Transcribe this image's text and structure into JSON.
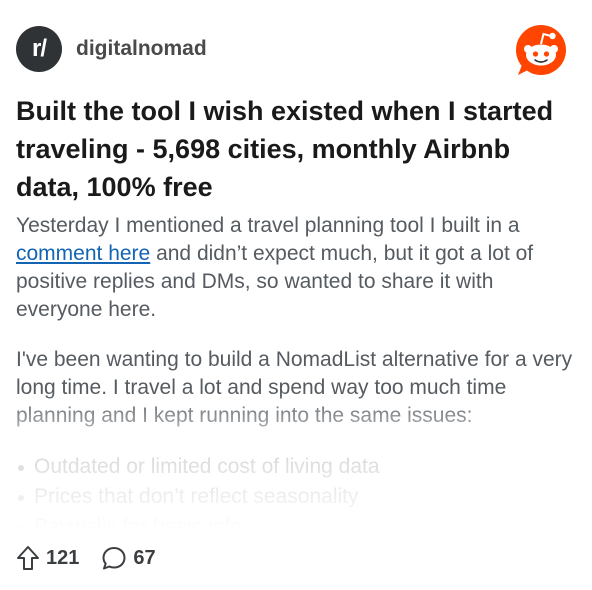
{
  "header": {
    "subreddit_icon": "r/",
    "subreddit_name": "digitalnomad",
    "logo": "reddit-snoo-icon"
  },
  "post": {
    "title": "Built the tool I wish existed when I started traveling - 5,698 cities, monthly Airbnb data, 100% free",
    "paragraph1_before_link": "Yesterday I mentioned a travel planning tool I built in a ",
    "paragraph1_link": "comment here",
    "paragraph1_after_link": " and didn’t expect much, but it got a lot of positive replies and DMs, so wanted to share it with everyone here.",
    "paragraph2": "I've been wanting to build a NomadList alternative for a very long time. I travel a lot and spend way too much time planning and I kept running into the same issues:",
    "bullets": [
      "Outdated or limited cost of living data",
      "Prices that don’t reflect seasonality",
      "Paywalls for basic info"
    ]
  },
  "footer": {
    "upvotes": "121",
    "comments": "67",
    "upvote_icon": "upvote-arrow-icon",
    "comment_icon": "comment-bubble-icon"
  },
  "colors": {
    "reddit_orange": "#ff4500",
    "link": "#1464b4",
    "subreddit_icon_bg": "#2f3336"
  }
}
